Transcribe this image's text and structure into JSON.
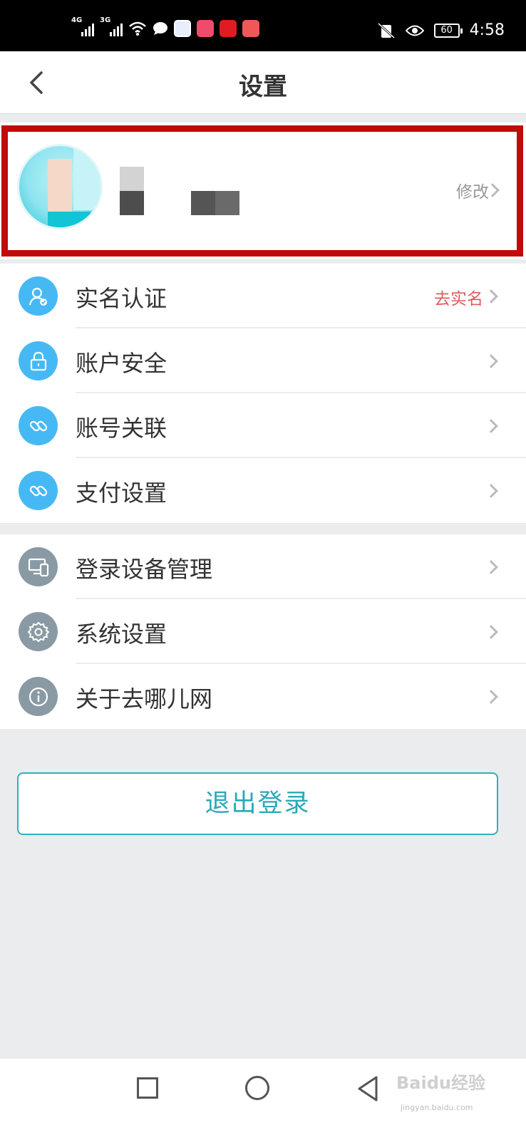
{
  "status_bar": {
    "network_1": "4G",
    "network_2": "3G",
    "battery": "60",
    "time": "4:58"
  },
  "header": {
    "title": "设置",
    "back_icon": "chevron-left-icon"
  },
  "profile": {
    "edit_label": "修改"
  },
  "group1": [
    {
      "label": "实名认证",
      "hint": "去实名",
      "icon": "user-verified-icon"
    },
    {
      "label": "账户安全",
      "hint": "",
      "icon": "lock-icon"
    },
    {
      "label": "账号关联",
      "hint": "",
      "icon": "link-icon"
    },
    {
      "label": "支付设置",
      "hint": "",
      "icon": "link-icon"
    }
  ],
  "group2": [
    {
      "label": "登录设备管理",
      "icon": "devices-icon"
    },
    {
      "label": "系统设置",
      "icon": "gear-icon"
    },
    {
      "label": "关于去哪儿网",
      "icon": "info-icon"
    }
  ],
  "logout_label": "退出登录",
  "watermark": {
    "main": "Baidu经验",
    "sub": "jingyan.baidu.com"
  },
  "colors": {
    "accent": "#2aa9b8",
    "icon_blue": "#46b9f4",
    "icon_gray": "#8a9aa4",
    "hint_red": "#e15b5b",
    "highlight_red": "#c20a0a"
  }
}
